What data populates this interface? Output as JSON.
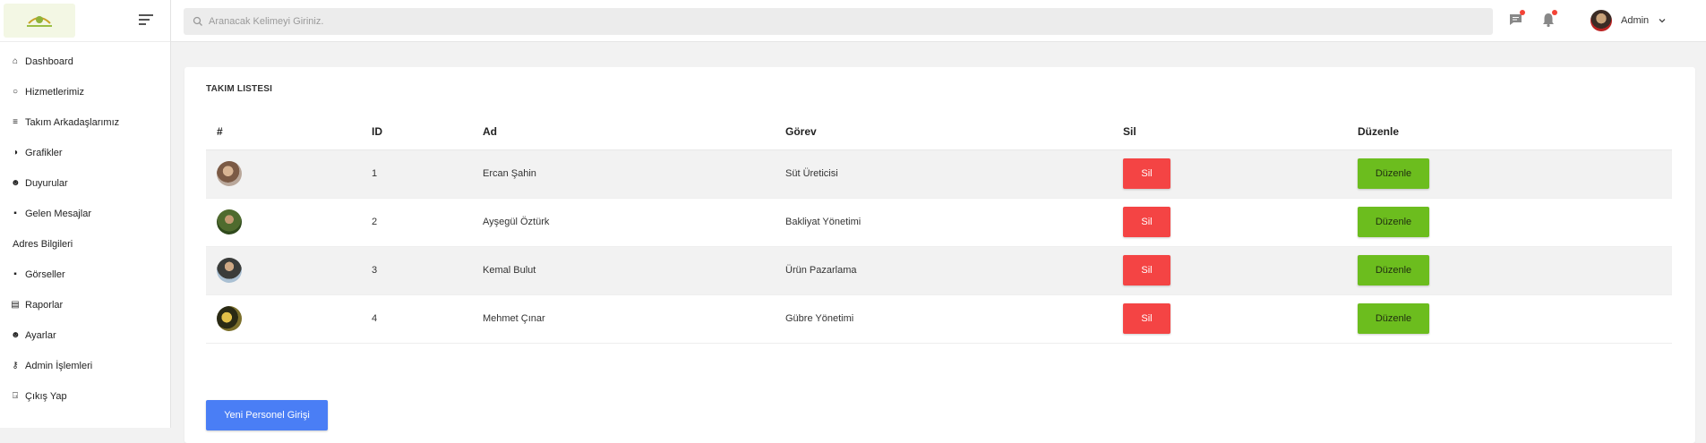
{
  "sidebar": {
    "items": [
      {
        "label": "Dashboard",
        "icon": "home-icon",
        "glyph": "⌂"
      },
      {
        "label": "Hizmetlerimiz",
        "icon": "circle-icon",
        "glyph": "○"
      },
      {
        "label": "Takım Arkadaşlarımız",
        "icon": "list-icon",
        "glyph": "≡"
      },
      {
        "label": "Grafikler",
        "icon": "pie-chart-icon",
        "glyph": "◑"
      },
      {
        "label": "Duyurular",
        "icon": "smiley-icon",
        "glyph": "☻"
      },
      {
        "label": "Gelen Mesajlar",
        "icon": "message-icon",
        "glyph": "▪"
      },
      {
        "label": "Adres Bilgileri",
        "icon": "",
        "glyph": ""
      },
      {
        "label": "Görseller",
        "icon": "image-icon",
        "glyph": "▪"
      },
      {
        "label": "Raporlar",
        "icon": "report-icon",
        "glyph": "▤"
      },
      {
        "label": "Ayarlar",
        "icon": "settings-icon",
        "glyph": "☻"
      },
      {
        "label": "Admin İşlemleri",
        "icon": "key-icon",
        "glyph": "⚷"
      },
      {
        "label": "Çıkış Yap",
        "icon": "exit-icon",
        "glyph": "⍈"
      }
    ]
  },
  "topbar": {
    "search_placeholder": "Aranacak Kelimeyi Giriniz.",
    "user_name": "Admin"
  },
  "card": {
    "title": "TAKIM LISTESI",
    "headers": [
      "#",
      "ID",
      "Ad",
      "Görev",
      "Sil",
      "Düzenle"
    ],
    "rows": [
      {
        "id": "1",
        "name": "Ercan Şahin",
        "role": "Süt Üreticisi",
        "delete_label": "Sil",
        "edit_label": "Düzenle"
      },
      {
        "id": "2",
        "name": "Ayşegül Öztürk",
        "role": "Bakliyat Yönetimi",
        "delete_label": "Sil",
        "edit_label": "Düzenle"
      },
      {
        "id": "3",
        "name": "Kemal Bulut",
        "role": "Ürün Pazarlama",
        "delete_label": "Sil",
        "edit_label": "Düzenle"
      },
      {
        "id": "4",
        "name": "Mehmet Çınar",
        "role": "Gübre Yönetimi",
        "delete_label": "Sil",
        "edit_label": "Düzenle"
      }
    ],
    "new_button_label": "Yeni Personel Girişi"
  },
  "colors": {
    "delete": "#f44444",
    "edit": "#6cbd1e",
    "primary": "#4a7ef5"
  }
}
